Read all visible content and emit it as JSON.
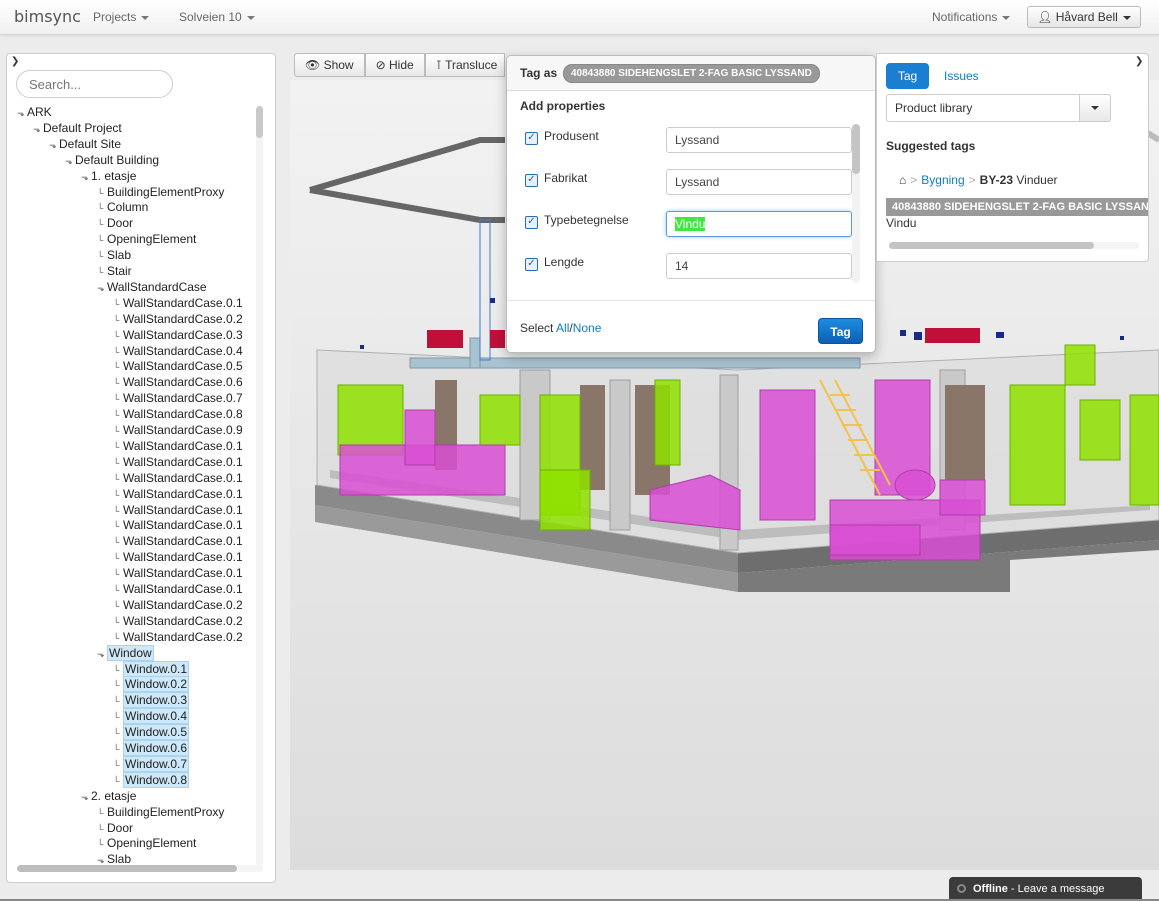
{
  "navbar": {
    "brand": "bimsync",
    "projects_label": "Projects",
    "project_name": "Solveien 10",
    "notifications_label": "Notifications",
    "user_name": "Håvard Bell"
  },
  "tree_panel": {
    "search_placeholder": "Search...",
    "nodes": [
      {
        "label": "ARK",
        "depth": 0,
        "expandable": true
      },
      {
        "label": "Default Project",
        "depth": 1,
        "expandable": true
      },
      {
        "label": "Default Site",
        "depth": 2,
        "expandable": true
      },
      {
        "label": "Default Building",
        "depth": 3,
        "expandable": true
      },
      {
        "label": "1. etasje",
        "depth": 4,
        "expandable": true
      },
      {
        "label": "BuildingElementProxy",
        "depth": 5
      },
      {
        "label": "Column",
        "depth": 5
      },
      {
        "label": "Door",
        "depth": 5
      },
      {
        "label": "OpeningElement",
        "depth": 5
      },
      {
        "label": "Slab",
        "depth": 5
      },
      {
        "label": "Stair",
        "depth": 5
      },
      {
        "label": "WallStandardCase",
        "depth": 5,
        "expandable": true
      },
      {
        "label": "WallStandardCase.0.1",
        "depth": 6
      },
      {
        "label": "WallStandardCase.0.2",
        "depth": 6
      },
      {
        "label": "WallStandardCase.0.3",
        "depth": 6
      },
      {
        "label": "WallStandardCase.0.4",
        "depth": 6
      },
      {
        "label": "WallStandardCase.0.5",
        "depth": 6
      },
      {
        "label": "WallStandardCase.0.6",
        "depth": 6
      },
      {
        "label": "WallStandardCase.0.7",
        "depth": 6
      },
      {
        "label": "WallStandardCase.0.8",
        "depth": 6
      },
      {
        "label": "WallStandardCase.0.9",
        "depth": 6
      },
      {
        "label": "WallStandardCase.0.1",
        "depth": 6
      },
      {
        "label": "WallStandardCase.0.1",
        "depth": 6
      },
      {
        "label": "WallStandardCase.0.1",
        "depth": 6
      },
      {
        "label": "WallStandardCase.0.1",
        "depth": 6
      },
      {
        "label": "WallStandardCase.0.1",
        "depth": 6
      },
      {
        "label": "WallStandardCase.0.1",
        "depth": 6
      },
      {
        "label": "WallStandardCase.0.1",
        "depth": 6
      },
      {
        "label": "WallStandardCase.0.1",
        "depth": 6
      },
      {
        "label": "WallStandardCase.0.1",
        "depth": 6
      },
      {
        "label": "WallStandardCase.0.1",
        "depth": 6
      },
      {
        "label": "WallStandardCase.0.2",
        "depth": 6
      },
      {
        "label": "WallStandardCase.0.2",
        "depth": 6
      },
      {
        "label": "WallStandardCase.0.2",
        "depth": 6
      },
      {
        "label": "Window",
        "depth": 5,
        "expandable": true,
        "selected": true
      },
      {
        "label": "Window.0.1",
        "depth": 6,
        "selected": true
      },
      {
        "label": "Window.0.2",
        "depth": 6,
        "selected": true
      },
      {
        "label": "Window.0.3",
        "depth": 6,
        "selected": true
      },
      {
        "label": "Window.0.4",
        "depth": 6,
        "selected": true
      },
      {
        "label": "Window.0.5",
        "depth": 6,
        "selected": true
      },
      {
        "label": "Window.0.6",
        "depth": 6,
        "selected": true
      },
      {
        "label": "Window.0.7",
        "depth": 6,
        "selected": true
      },
      {
        "label": "Window.0.8",
        "depth": 6,
        "selected": true
      },
      {
        "label": "2. etasje",
        "depth": 4,
        "expandable": true
      },
      {
        "label": "BuildingElementProxy",
        "depth": 5
      },
      {
        "label": "Door",
        "depth": 5
      },
      {
        "label": "OpeningElement",
        "depth": 5
      },
      {
        "label": "Slab",
        "depth": 5,
        "expandable": true
      }
    ]
  },
  "toolbar": {
    "show_label": "Show",
    "hide_label": "Hide",
    "translucent_label": "Transluce"
  },
  "popover": {
    "title_prefix": "Tag as",
    "tag_name": "40843880 SIDEHENGSLET 2-FAG BASIC LYSSAND",
    "section_label": "Add properties",
    "properties": [
      {
        "label": "Produsent",
        "value": "Lyssand",
        "checked": true
      },
      {
        "label": "Fabrikat",
        "value": "Lyssand",
        "checked": true
      },
      {
        "label": "Typebetegnelse",
        "value": "Vindu",
        "checked": true,
        "focused": true
      },
      {
        "label": "Lengde",
        "value": "14",
        "checked": true
      }
    ],
    "select_prefix": "Select",
    "select_all": "All",
    "select_sep": "/",
    "select_none": "None",
    "tag_button": "Tag"
  },
  "right_panel": {
    "tab_tag": "Tag",
    "tab_issues": "Issues",
    "library_select": "Product library",
    "suggested_heading": "Suggested tags",
    "breadcrumb": {
      "link": "Bygning",
      "code": "BY-23",
      "name": "Vinduer"
    },
    "suggested_tag": "40843880 SIDEHENGSLET 2-FAG BASIC LYSSAND",
    "suggested_value": "Vindu"
  },
  "chat": {
    "status": "Offline",
    "message": "- Leave a message"
  },
  "colors": {
    "accent": "#1a7ed1",
    "selection": "#cde8f8",
    "magenta_furniture": "#d94fd4",
    "green_windows": "#8fe000",
    "slab_gray": "#808080"
  }
}
